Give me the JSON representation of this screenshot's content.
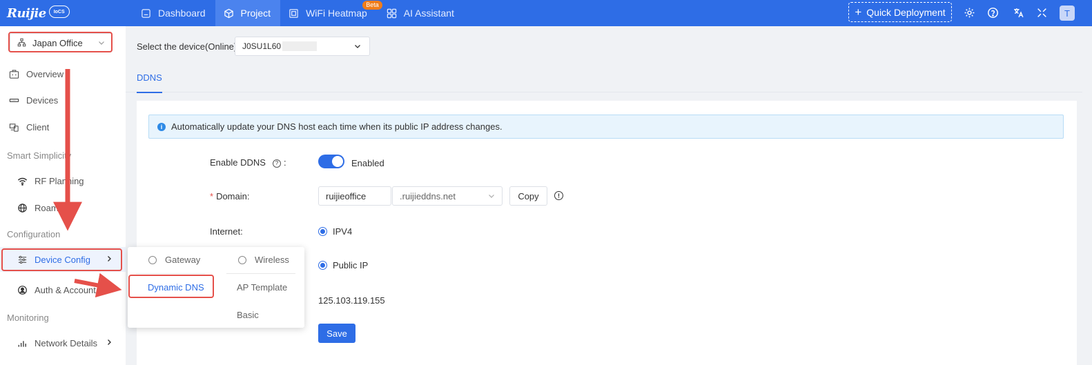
{
  "brand": {
    "name": "Ruijie",
    "badge": "IoCS"
  },
  "nav": {
    "items": [
      {
        "label": "Dashboard",
        "icon": "dashboard-icon",
        "active": false
      },
      {
        "label": "Project",
        "icon": "cube-icon",
        "active": true
      },
      {
        "label": "WiFi Heatmap",
        "icon": "heatmap-icon",
        "active": false,
        "badge": "Beta"
      },
      {
        "label": "AI Assistant",
        "icon": "grid-icon",
        "active": false
      }
    ],
    "quick_deploy": "Quick Deployment",
    "avatar_letter": "T",
    "icons": [
      "gear-icon",
      "help-icon",
      "translate-icon",
      "fullscreen-icon"
    ]
  },
  "sidebar": {
    "project": "Japan Office",
    "items": {
      "overview": "Overview",
      "devices": "Devices",
      "client": "Client",
      "smart_simplicity": "Smart Simplicity",
      "rf_planning": "RF Planning",
      "roaming": "Roaming",
      "configuration": "Configuration",
      "device_config": "Device Config",
      "auth_account": "Auth & Account",
      "monitoring": "Monitoring",
      "network_details": "Network Details"
    }
  },
  "flyout": {
    "gateway": "Gateway",
    "wireless": "Wireless",
    "dynamic_dns": "Dynamic DNS",
    "ap_template": "AP Template",
    "basic": "Basic"
  },
  "main": {
    "device_label": "Select the device(Online):",
    "device_value": "J0SU1L60",
    "tab": "DDNS",
    "alert": "Automatically update your DNS host each time when its public IP address changes.",
    "form": {
      "enable_label": "Enable DDNS",
      "enable_colon": ":",
      "enable_state": "Enabled",
      "domain_label": "Domain:",
      "domain_value": "ruijieoffice",
      "domain_suffix": ".ruijieddns.net",
      "copy_label": "Copy",
      "internet_label": "Internet:",
      "internet_value": "IPV4",
      "ip_type_value": "Public IP",
      "ip_value": "125.103.119.155",
      "save_label": "Save"
    }
  },
  "colors": {
    "primary": "#2e6de6",
    "annotation": "#e5504a"
  }
}
